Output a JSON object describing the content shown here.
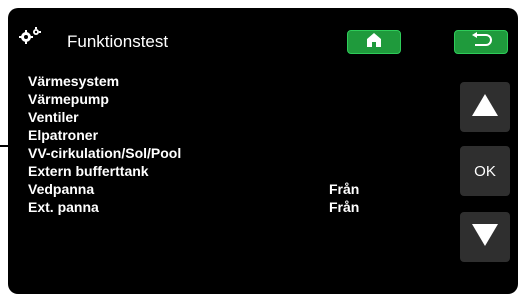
{
  "header": {
    "title": "Funktionstest"
  },
  "items": [
    {
      "label": "Värmesystem",
      "value": ""
    },
    {
      "label": "Värmepump",
      "value": ""
    },
    {
      "label": "Ventiler",
      "value": ""
    },
    {
      "label": "Elpatroner",
      "value": ""
    },
    {
      "label": "VV-cirkulation/Sol/Pool",
      "value": ""
    },
    {
      "label": "Extern bufferttank",
      "value": ""
    },
    {
      "label": "Vedpanna",
      "value": "Från"
    },
    {
      "label": "Ext. panna",
      "value": "Från"
    }
  ],
  "nav": {
    "ok_label": "OK"
  },
  "colors": {
    "background": "#000000",
    "accent_green": "#1f9a3c",
    "button_gray": "#2f2f2f",
    "text": "#ffffff"
  },
  "icons": {
    "header": "gears-icon",
    "home": "home-icon",
    "back": "back-arrow-icon",
    "up": "arrow-up-icon",
    "down": "arrow-down-icon"
  }
}
